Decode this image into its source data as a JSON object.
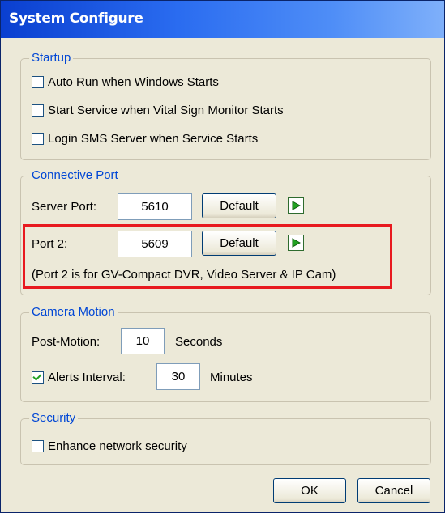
{
  "window": {
    "title": "System Configure"
  },
  "startup": {
    "label": "Startup",
    "options": [
      {
        "label": "Auto Run when Windows Starts",
        "checked": false
      },
      {
        "label": "Start Service when Vital Sign Monitor Starts",
        "checked": false
      },
      {
        "label": "Login SMS Server when Service Starts",
        "checked": false
      }
    ]
  },
  "connective_port": {
    "label": "Connective Port",
    "server_port": {
      "label": "Server Port:",
      "value": "5610",
      "default_label": "Default"
    },
    "port2": {
      "label": "Port 2:",
      "value": "5609",
      "default_label": "Default",
      "note": "(Port 2 is for GV-Compact DVR, Video Server & IP Cam)"
    }
  },
  "camera_motion": {
    "label": "Camera Motion",
    "post_motion": {
      "label": "Post-Motion:",
      "value": "10",
      "unit": "Seconds"
    },
    "alerts_interval": {
      "label": "Alerts Interval:",
      "checked": true,
      "value": "30",
      "unit": "Minutes"
    }
  },
  "security": {
    "label": "Security",
    "enhance": {
      "label": "Enhance network security",
      "checked": false
    }
  },
  "footer": {
    "ok_label": "OK",
    "cancel_label": "Cancel"
  },
  "colors": {
    "title_bar": "#0a3fd0",
    "group_label": "#0046d5",
    "highlight": "#e8191f",
    "arrow": "#21a121"
  }
}
